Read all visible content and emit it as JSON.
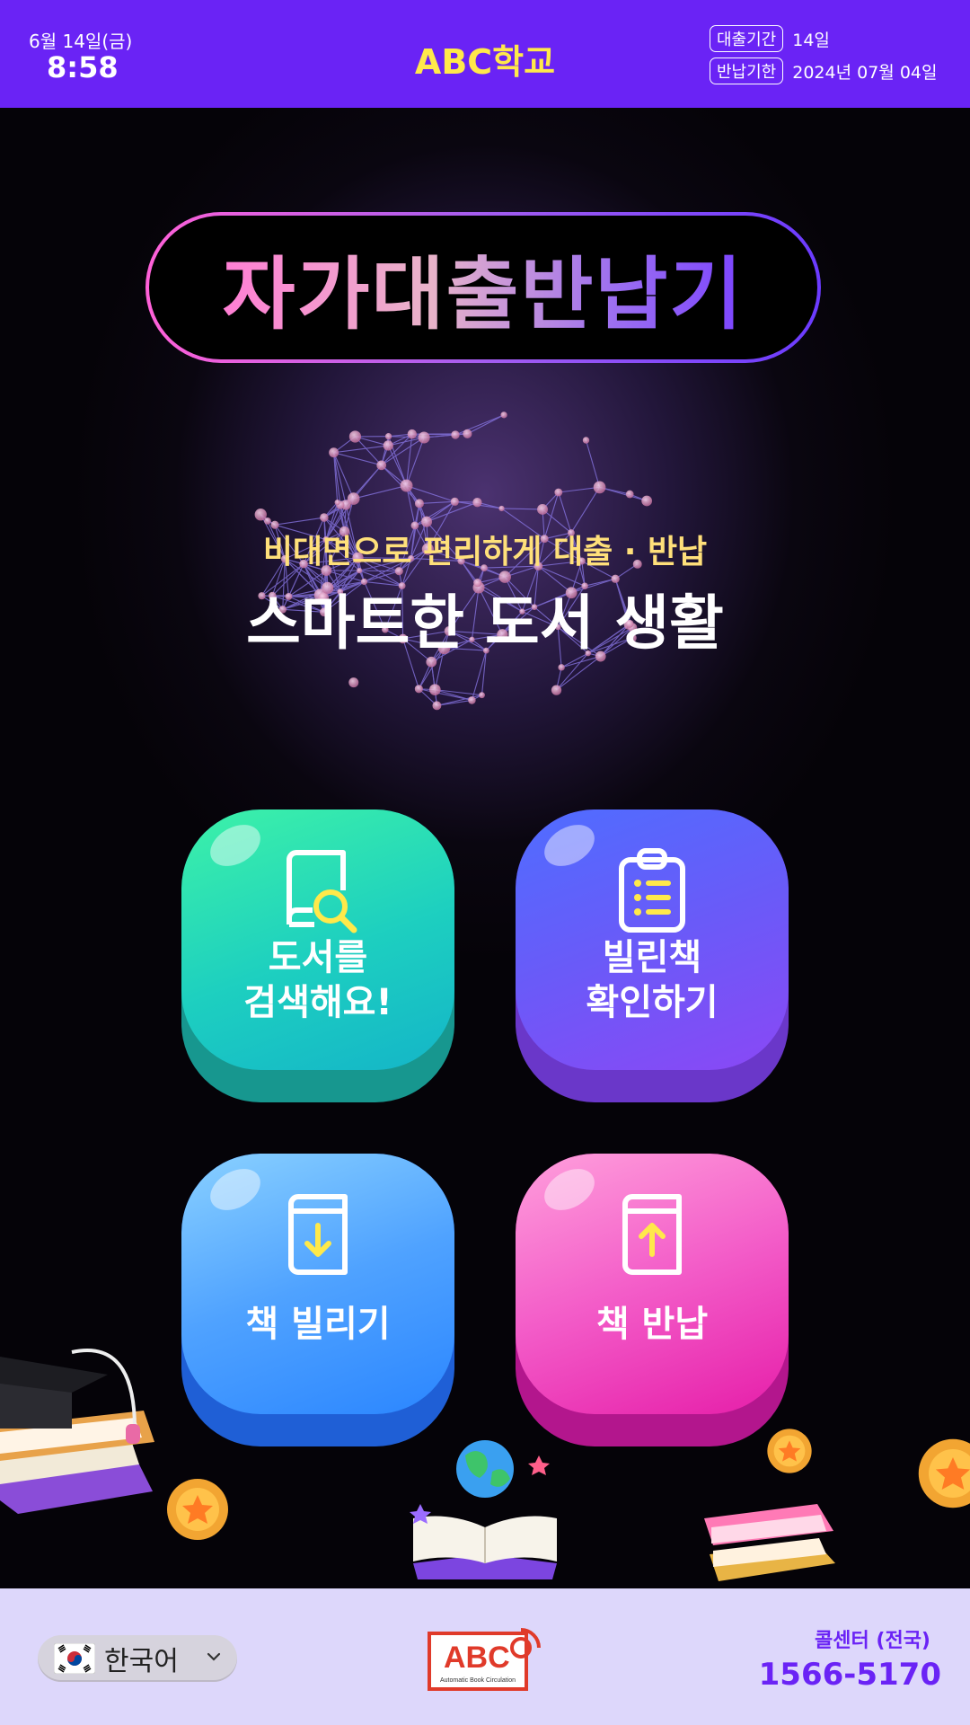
{
  "header": {
    "date": "6월 14일(금)",
    "time": "8:58",
    "school": "ABC학교",
    "loan_period_label": "대출기간",
    "loan_period_value": "14일",
    "due_label": "반납기한",
    "due_value": "2024년 07월 04일"
  },
  "main": {
    "title": "자가대출반납기",
    "subtitle": "비대면으로 편리하게 대출 · 반납",
    "headline": "스마트한 도서 생활",
    "buttons": [
      {
        "line1": "도서를",
        "line2": "검색해요!",
        "icon": "book-search-icon"
      },
      {
        "line1": "빌린책",
        "line2": "확인하기",
        "icon": "clipboard-list-icon"
      },
      {
        "line1": "책 빌리기",
        "icon": "book-download-icon"
      },
      {
        "line1": "책 반납",
        "icon": "book-upload-icon"
      }
    ]
  },
  "footer": {
    "language": "한국어",
    "logo_text": "ABC",
    "logo_tagline": "Automatic Book Circulation",
    "call_label": "콜센터 (전국)",
    "call_number": "1566-5170"
  },
  "colors": {
    "header_bg": "#6a23f5",
    "school_name": "#ffe94a",
    "footer_bg": "#ddd7fb",
    "accent": "#6a23f5"
  }
}
